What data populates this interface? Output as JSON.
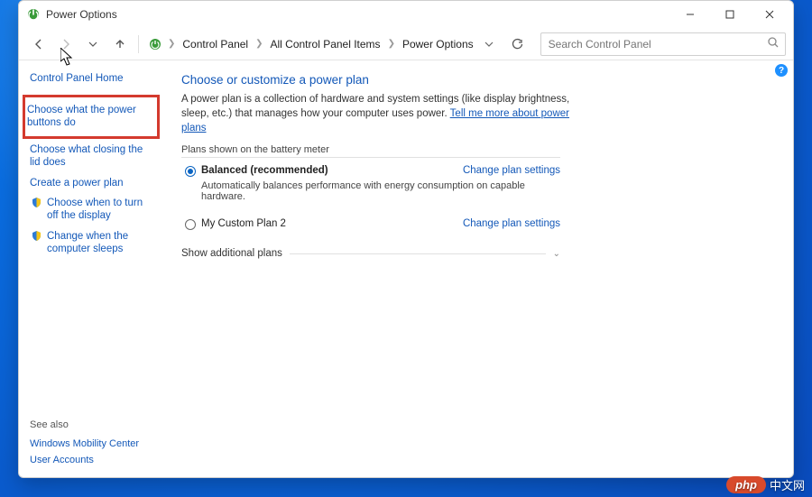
{
  "window": {
    "title": "Power Options"
  },
  "breadcrumbs": {
    "items": [
      "Control Panel",
      "All Control Panel Items",
      "Power Options"
    ]
  },
  "search": {
    "placeholder": "Search Control Panel"
  },
  "sidebar": {
    "home": "Control Panel Home",
    "links": [
      {
        "label": "Choose what the power buttons do",
        "highlight": true
      },
      {
        "label": "Choose what closing the lid does"
      },
      {
        "label": "Create a power plan"
      },
      {
        "label": "Choose when to turn off the display",
        "shield": true
      },
      {
        "label": "Change when the computer sleeps",
        "shield": true
      }
    ],
    "see_also_label": "See also",
    "see_also": [
      "Windows Mobility Center",
      "User Accounts"
    ]
  },
  "main": {
    "heading": "Choose or customize a power plan",
    "description_pre": "A power plan is a collection of hardware and system settings (like display brightness, sleep, etc.) that manages how your computer uses power. ",
    "description_link": "Tell me more about power plans",
    "section_label": "Plans shown on the battery meter",
    "plans": [
      {
        "name": "Balanced (recommended)",
        "selected": true,
        "sub": "Automatically balances performance with energy consumption on capable hardware.",
        "link": "Change plan settings"
      },
      {
        "name": "My Custom Plan 2",
        "selected": false,
        "link": "Change plan settings"
      }
    ],
    "expander": "Show additional plans"
  },
  "watermark": {
    "badge": "php",
    "text": "中文网"
  }
}
